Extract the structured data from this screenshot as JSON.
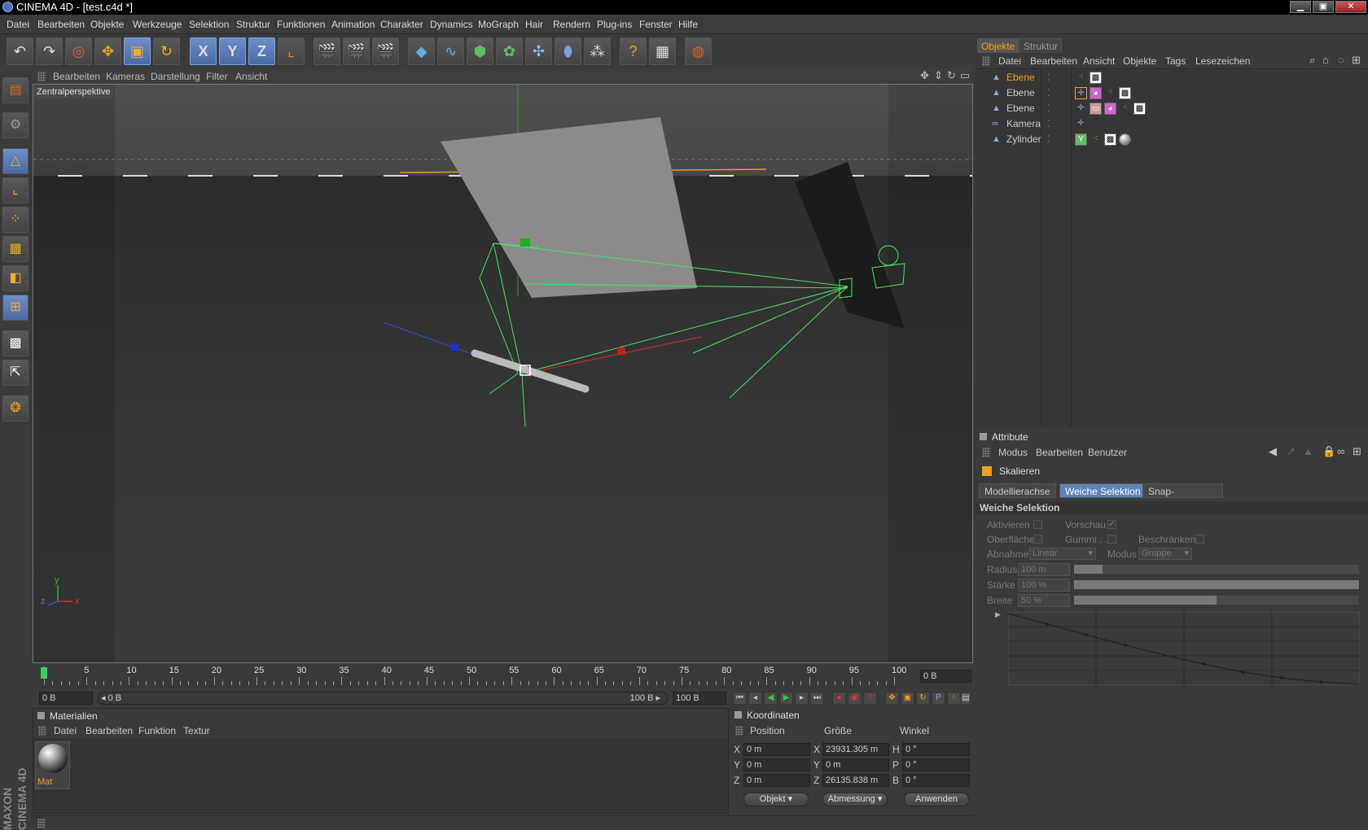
{
  "window": {
    "title": "CINEMA 4D - [test.c4d *]",
    "min": "▁",
    "max": "▣",
    "close": "✕"
  },
  "menu": [
    "Datei",
    "Bearbeiten",
    "Objekte",
    "Werkzeuge",
    "Selektion",
    "Struktur",
    "Funktionen",
    "Animation",
    "Charakter",
    "Dynamics",
    "MoGraph",
    "Hair",
    "Rendern",
    "Plug-ins",
    "Fenster",
    "Hilfe"
  ],
  "toolbar": {
    "undo": "undo-icon",
    "redo": "redo-icon",
    "select": "live-selection-icon",
    "move": "move-icon",
    "scale": "scale-icon",
    "rotate": "rotate-icon",
    "axis_x": "X",
    "axis_y": "Y",
    "axis_z": "Z"
  },
  "viewport": {
    "menu": [
      "Bearbeiten",
      "Kameras",
      "Darstellung",
      "Filter",
      "Ansicht"
    ],
    "camera_label": "Zentralperspektive",
    "axis_y": "y",
    "axis_z": "z",
    "axis_x": "x"
  },
  "timeline": {
    "ticks": [
      "0",
      "5",
      "10",
      "15",
      "20",
      "25",
      "30",
      "35",
      "40",
      "45",
      "50",
      "55",
      "60",
      "65",
      "70",
      "75",
      "80",
      "85",
      "90",
      "95",
      "100"
    ],
    "current_frame": "0 B",
    "start_field": "0 B",
    "range_start": "◂ 0 B",
    "range_end": "100 B ▸",
    "end_field": "100 B"
  },
  "materials": {
    "header": "Materialien",
    "menu": [
      "Datei",
      "Bearbeiten",
      "Funktion",
      "Textur"
    ],
    "items": [
      {
        "name": "Mat"
      }
    ]
  },
  "coordinates": {
    "header": "Koordinaten",
    "col_position": "Position",
    "col_size": "Größe",
    "col_angle": "Winkel",
    "rows": [
      {
        "axis": "X",
        "pos": "0 m",
        "size_axis": "X",
        "size": "23931.305 m",
        "ang_axis": "H",
        "ang": "0 °"
      },
      {
        "axis": "Y",
        "pos": "0 m",
        "size_axis": "Y",
        "size": "0 m",
        "ang_axis": "P",
        "ang": "0 °"
      },
      {
        "axis": "Z",
        "pos": "0 m",
        "size_axis": "Z",
        "size": "26135.838 m",
        "ang_axis": "B",
        "ang": "0 °"
      }
    ],
    "mode": "Objekt",
    "size_mode": "Abmessung",
    "apply": "Anwenden"
  },
  "objects": {
    "tabs": [
      "Objekte",
      "Struktur"
    ],
    "menu": [
      "Datei",
      "Bearbeiten",
      "Ansicht",
      "Objekte",
      "Tags",
      "Lesezeichen"
    ],
    "items": [
      {
        "name": "Ebene",
        "selected": true
      },
      {
        "name": "Ebene",
        "selected": false
      },
      {
        "name": "Ebene",
        "selected": false
      },
      {
        "name": "Kamera",
        "selected": false
      },
      {
        "name": "Zylinder",
        "selected": false
      }
    ]
  },
  "attributes": {
    "header": "Attribute",
    "menu": [
      "Modus",
      "Bearbeiten",
      "Benutzer"
    ],
    "tool": "Skalieren",
    "tabs": [
      {
        "label": "Modellierachse",
        "active": false
      },
      {
        "label": "Weiche Selektion",
        "active": true
      },
      {
        "label": "Snap-Einstellungen",
        "active": false
      }
    ],
    "section": "Weiche Selektion",
    "aktivieren": "Aktivieren",
    "vorschau": "Vorschau",
    "vorschau_check": "✓",
    "oberflaeche": "Oberfläche",
    "gummi": "Gummi . .",
    "beschraenken": "Beschränken",
    "abnahme": "Abnahme",
    "abnahme_val": "Linear",
    "modus": "Modus",
    "modus_val": "Gruppe",
    "radius": "Radius",
    "radius_val": "100 m",
    "radius_frac": 0.1,
    "staerke": "Stärke",
    "staerke_val": "100 %",
    "staerke_frac": 1.0,
    "breite": "Breite",
    "breite_val": "50 %",
    "breite_frac": 0.5
  }
}
